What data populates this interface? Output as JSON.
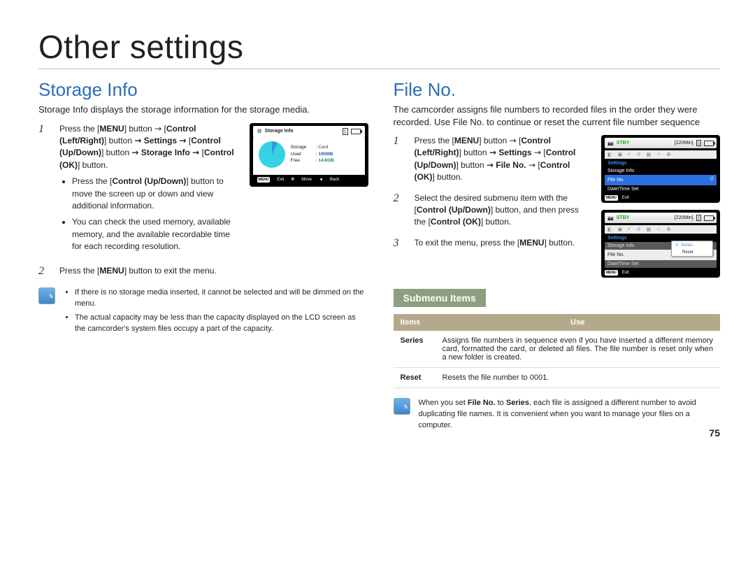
{
  "page": {
    "title": "Other settings",
    "number": "75"
  },
  "left": {
    "heading": "Storage Info",
    "intro": "Storage Info displays the storage information for the storage media.",
    "step1_a": "Press the [",
    "step1_menu": "MENU",
    "step1_b": "] button ",
    "step1_arrow": "→",
    "step1_c": " [",
    "step1_ctrlLR": "Control (Left/Right)",
    "step1_d": "] button ",
    "step1_e": "Settings",
    "step1_f": " [",
    "step1_ctrlUD": "Control (Up/Down)",
    "step1_g": "] button ",
    "step1_h": "Storage Info",
    "step1_i": " [",
    "step1_ctrlOK": "Control (OK)",
    "step1_j": "] button.",
    "bullet1_a": "Press the [",
    "bullet1_b": "] button to move the screen up or down and view additional information.",
    "bullet2": "You can check the used memory, available memory, and the available recordable time for each recording resolution.",
    "step2_a": "Press the [",
    "step2_b": "] button to exit the menu.",
    "note1": "If there is no storage media inserted, it cannot be selected and will be dimmed on the menu.",
    "note2": "The actual capacity may be less than the capacity displayed on the LCD screen as the camcorder's system files occupy a part of the capacity."
  },
  "right": {
    "heading": "File No.",
    "intro": "The camcorder assigns file numbers to recorded files in the order they were recorded. Use File No. to continue or reset the current file number sequence",
    "step1_a": "Press the [",
    "step1_b": "] button ",
    "step1_c": " [",
    "step1_d": "] button ",
    "step1_settings": "Settings",
    "step1_e": " [",
    "step1_f": "] button ",
    "step1_fileno": "File No.",
    "step1_g": " [",
    "step1_h": "] button.",
    "step2": "Select the desired submenu item with the [Control (Up/Down)] button, and then press the [Control (OK)] button.",
    "step2_a": "Select the desired submenu item with the [",
    "step2_b": "] button, and then press the [",
    "step2_c": "] button.",
    "step3_a": "To exit the menu, press the [",
    "step3_b": "] button.",
    "submenu_heading": "Submenu Items",
    "table": {
      "col1": "Items",
      "col2": "Use",
      "rows": [
        {
          "name": "Series",
          "desc": "Assigns file numbers in sequence even if you have inserted a different memory card, formatted the card, or deleted all files. The file number is reset only when a new folder is created."
        },
        {
          "name": "Reset",
          "desc": "Resets the file number to 0001."
        }
      ]
    },
    "note_a": "When you set ",
    "note_b": " to ",
    "note_c": ", each file is assigned a different number to avoid duplicating file names. It is convenient when you want to manage your files on a computer."
  },
  "osd_storage": {
    "title": "Storage Info",
    "storage_lbl": "Storage",
    "storage_val": ": Card",
    "used_lbl": "Used",
    "used_val": ": 190MB",
    "free_lbl": "Free",
    "free_val": ": 14.6GB",
    "exit": "Exit",
    "move": "Move",
    "back": "Back"
  },
  "osd_menu": {
    "stby": "STBY",
    "min": "[220Min]",
    "settings": "Settings",
    "storage_info": "Storage Info",
    "file_no": "File No.",
    "date_time": "Date/Time Set",
    "exit": "Exit",
    "series": "Series",
    "reset": "Reset"
  }
}
